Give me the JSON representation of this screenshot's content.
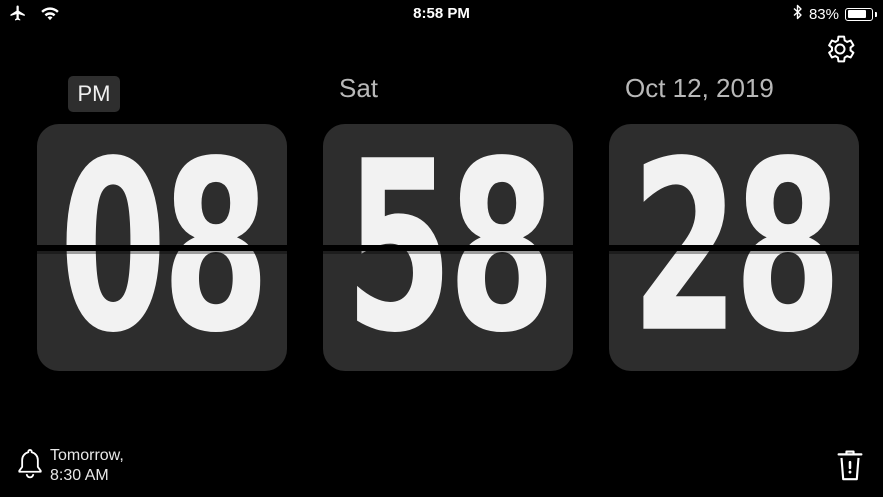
{
  "status_bar": {
    "time": "8:58 PM",
    "battery_percent": "83%",
    "battery_level": 0.83,
    "icons": [
      "airplane-icon",
      "wifi-icon",
      "bluetooth-icon",
      "battery-icon"
    ]
  },
  "clock": {
    "meridiem": "PM",
    "weekday": "Sat",
    "date": "Oct 12, 2019",
    "hours": "08",
    "minutes": "58",
    "seconds": "28"
  },
  "alarm": {
    "line1": "Tomorrow,",
    "line2": "8:30 AM",
    "icon": "bell-icon"
  },
  "toolbar": {
    "settings_icon": "gear-icon",
    "delete_icon": "trash-icon"
  },
  "colors": {
    "background": "#000000",
    "card": "#2d2d2d",
    "digit": "#f2f2f2",
    "label": "#b8b8b8"
  }
}
